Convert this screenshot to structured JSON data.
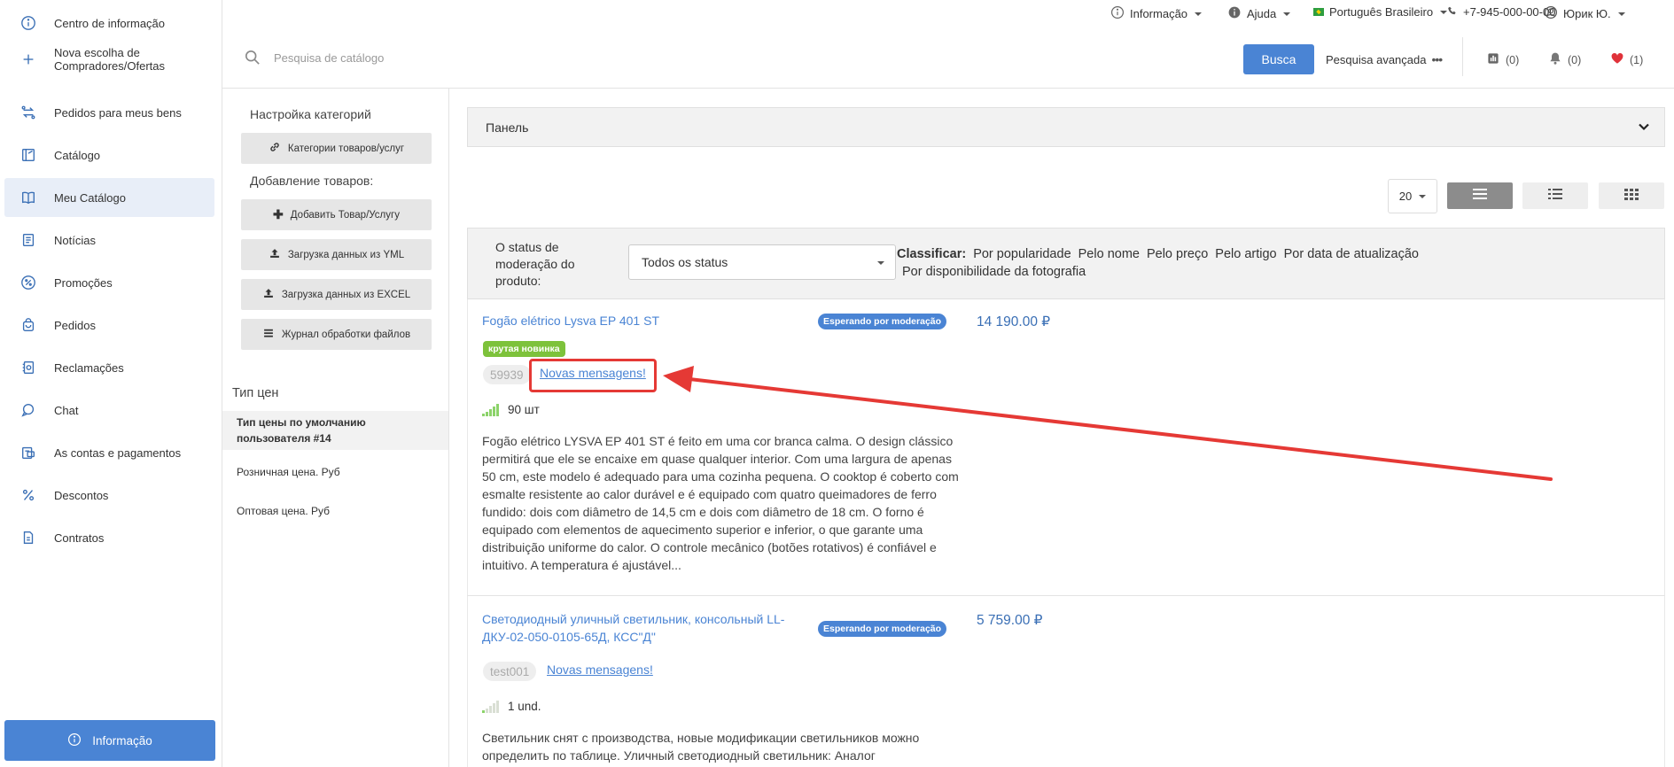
{
  "sidebar": {
    "items": [
      {
        "label": "Centro de informação",
        "icon": "info-circle-icon"
      },
      {
        "label": "Nova escolha de Compradores/Ofertas",
        "icon": "plus-icon"
      },
      {
        "label": "Pedidos para meus bens",
        "icon": "exchange-icon"
      },
      {
        "label": "Catálogo",
        "icon": "catalog-icon"
      },
      {
        "label": "Meu Catálogo",
        "icon": "book-icon"
      },
      {
        "label": "Notícias",
        "icon": "news-icon"
      },
      {
        "label": "Promoções",
        "icon": "percent-badge-icon"
      },
      {
        "label": "Pedidos",
        "icon": "bag-icon"
      },
      {
        "label": "Reclamações",
        "icon": "complaint-icon"
      },
      {
        "label": "Chat",
        "icon": "chat-icon"
      },
      {
        "label": "As contas e pagamentos",
        "icon": "invoice-icon"
      },
      {
        "label": "Descontos",
        "icon": "percent-icon"
      },
      {
        "label": "Contratos",
        "icon": "document-icon"
      }
    ],
    "active_index": 4,
    "info_button_label": "Informação"
  },
  "topbar": {
    "info_label": "Informação",
    "help_label": "Ajuda",
    "language_label": "Português Brasileiro",
    "phone": "+7-945-000-00-00",
    "user_label": "Юрик Ю."
  },
  "search": {
    "placeholder": "Pesquisa de catálogo",
    "button_label": "Busca",
    "advanced_label": "Pesquisa avançada",
    "compare_count": "(0)",
    "notifications_count": "(0)",
    "favorites_count": "(1)"
  },
  "categories": {
    "settings_heading": "Настройка категорий",
    "categories_button": "Категории товаров/услуг",
    "add_heading": "Добавление товаров:",
    "add_product_button": "Добавить Товар/Услугу",
    "yml_button": "Загрузка данных из YML",
    "excel_button": "Загрузка данных из EXCEL",
    "journal_button": "Журнал обработки файлов"
  },
  "price_types": {
    "title": "Тип цен",
    "options": [
      "Тип цены по умолчанию пользователя #14",
      "Розничная цена. Руб",
      "Оптовая цена. Руб"
    ]
  },
  "panel": {
    "title": "Панель"
  },
  "pagination": {
    "per_page": "20"
  },
  "filters": {
    "moderation_label": "O status de moderação do produto:",
    "status_value": "Todos os status",
    "sort_label": "Classificar:",
    "sort_options": [
      "Por popularidade",
      "Pelo nome",
      "Pelo preço",
      "Pelo artigo",
      "Por data de atualização",
      "Por disponibilidade da fotografia"
    ]
  },
  "products": [
    {
      "title": "Fogão elétrico Lysva EP 401 ST",
      "moderation": "Esperando por moderação",
      "price": "14 190.00 ₽",
      "badge": "крутая новинка",
      "sku": "59939",
      "messages_link": "Novas mensagens!",
      "stock": "90 шт",
      "description": "Fogão elétrico LYSVA EP 401 ST é feito em uma cor branca calma. O design clássico permitirá que ele se encaixe em quase qualquer interior. Com uma largura de apenas 50 cm, este modelo é adequado para uma cozinha pequena. O cooktop é coberto com esmalte resistente ao calor durável e é equipado com quatro queimadores de ferro fundido: dois com diâmetro de 14,5 cm e dois com diâmetro de 18 cm. O forno é equipado com elementos de aquecimento superior e inferior, o que garante uma distribuição uniforme do calor. O controle mecânico (botões rotativos) é confiável e intuitivo. A temperatura é ajustável..."
    },
    {
      "title": "Светодиодный уличный светильник, консольный LL-ДКУ-02-050-0105-65Д, КСС\"Д\"",
      "moderation": "Esperando por moderação",
      "price": "5 759.00 ₽",
      "sku": "test001",
      "messages_link": "Novas mensagens!",
      "stock": "1 und.",
      "description": "Светильник снят с производства, новые модификации светильников можно определить по таблице. Уличный светодиодный светильник: Аналог"
    }
  ],
  "colors": {
    "accent": "#4a84d4",
    "new_badge": "#7dc23b",
    "annotation": "#e53935",
    "active_nav": "#e8eef8"
  }
}
